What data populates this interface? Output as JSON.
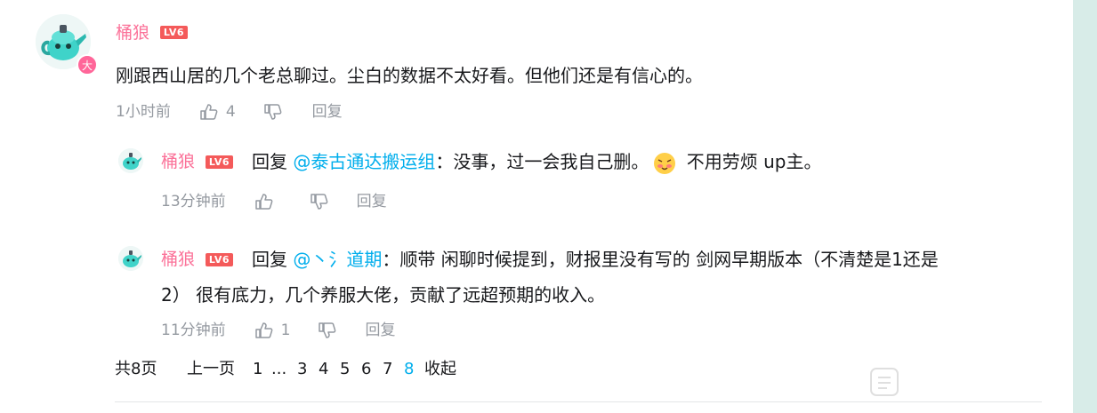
{
  "main_comment": {
    "user": "桶狼",
    "level": "LV6",
    "badge": "大",
    "text": "刚跟西山居的几个老总聊过。尘白的数据不太好看。但他们还是有信心的。",
    "time": "1小时前",
    "likes": "4",
    "reply_label": "回复"
  },
  "replies": [
    {
      "user": "桶狼",
      "level": "LV6",
      "reply_word": "回复",
      "mention": "@泰古通达搬运组",
      "text_before_emoji": "：没事，过一会我自己删。",
      "text_after_emoji": " 不用劳烦 up主。",
      "time": "13分钟前",
      "reply_label": "回复"
    },
    {
      "user": "桶狼",
      "level": "LV6",
      "reply_word": "回复",
      "mention": "@丶氵道期",
      "text_line1": "：顺带 闲聊时候提到，财报里没有写的 剑网早期版本（不清楚是1还是",
      "text_line2": "2） 很有底力，几个养服大佬，贡献了远超预期的收入。",
      "time": "11分钟前",
      "likes": "1",
      "reply_label": "回复"
    }
  ],
  "pagination": {
    "total": "共8页",
    "prev": "上一页",
    "pages": [
      "1",
      "...",
      "3",
      "4",
      "5",
      "6",
      "7",
      "8"
    ],
    "current": "8",
    "collapse": "收起"
  },
  "colors": {
    "username": "#fb7299",
    "mention": "#00aeec",
    "level_badge": "#f45a5a",
    "meta": "#9499a0"
  }
}
